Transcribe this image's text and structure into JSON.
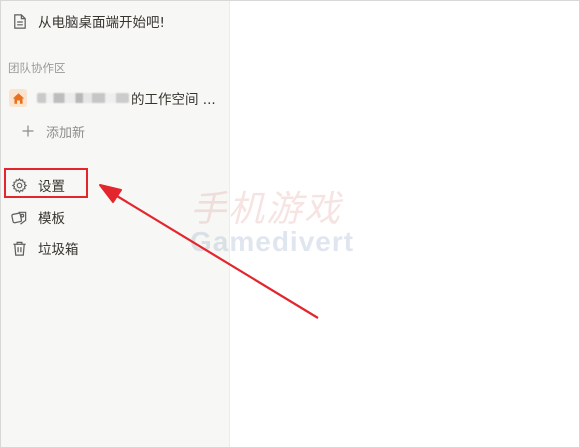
{
  "sidebar": {
    "welcome_page": {
      "icon": "document-icon",
      "label": "从电脑桌面端开始吧!"
    },
    "team_section_label": "团队协作区",
    "workspace": {
      "icon": "home-icon",
      "label": "的工作空间 ...",
      "icon_color": "#e8711f"
    },
    "add_new": {
      "icon": "plus-icon",
      "label": "添加新"
    },
    "nav": [
      {
        "icon": "gear-icon",
        "label": "设置"
      },
      {
        "icon": "template-icon",
        "label": "模板"
      },
      {
        "icon": "trash-icon",
        "label": "垃圾箱"
      }
    ]
  },
  "watermark": {
    "line1": "手机游戏",
    "line2": "Gamedivert"
  },
  "annotation": {
    "color": "#e3262d"
  }
}
